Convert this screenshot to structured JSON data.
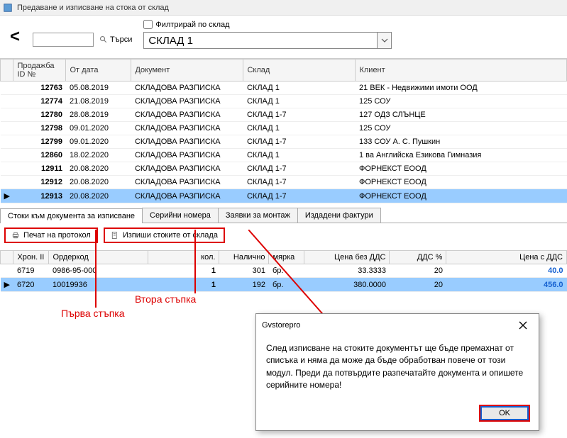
{
  "window": {
    "title": "Предаване и изписване на стока от склад"
  },
  "toolbar": {
    "back": "<",
    "search_btn": "Търси",
    "filter_label": "Филтрирай по склад",
    "warehouse": "СКЛАД 1"
  },
  "grid": {
    "headers": {
      "id": "Продажба ID №",
      "date": "От дата",
      "doc": "Документ",
      "whs": "Склад",
      "client": "Клиент"
    },
    "rows": [
      {
        "mark": "",
        "id": "12763",
        "date": "05.08.2019",
        "doc": "СКЛАДОВА РАЗПИСКА",
        "whs": "СКЛАД 1",
        "client": "21 ВЕК - Недвижими имоти ООД"
      },
      {
        "mark": "",
        "id": "12774",
        "date": "21.08.2019",
        "doc": "СКЛАДОВА РАЗПИСКА",
        "whs": "СКЛАД 1",
        "client": "125 СОУ"
      },
      {
        "mark": "",
        "id": "12780",
        "date": "28.08.2019",
        "doc": "СКЛАДОВА РАЗПИСКА",
        "whs": "СКЛАД 1-7",
        "client": "127 ОДЗ СЛЪНЦЕ"
      },
      {
        "mark": "",
        "id": "12798",
        "date": "09.01.2020",
        "doc": "СКЛАДОВА РАЗПИСКА",
        "whs": "СКЛАД 1",
        "client": "125 СОУ"
      },
      {
        "mark": "",
        "id": "12799",
        "date": "09.01.2020",
        "doc": "СКЛАДОВА РАЗПИСКА",
        "whs": "СКЛАД 1-7",
        "client": "133 СОУ А. С. Пушкин"
      },
      {
        "mark": "",
        "id": "12860",
        "date": "18.02.2020",
        "doc": "СКЛАДОВА РАЗПИСКА",
        "whs": "СКЛАД 1",
        "client": "1 ва Английска Езикова Гимназия"
      },
      {
        "mark": "",
        "id": "12911",
        "date": "20.08.2020",
        "doc": "СКЛАДОВА РАЗПИСКА",
        "whs": "СКЛАД 1-7",
        "client": "ФОРНЕКСТ ЕООД"
      },
      {
        "mark": "",
        "id": "12912",
        "date": "20.08.2020",
        "doc": "СКЛАДОВА РАЗПИСКА",
        "whs": "СКЛАД 1-7",
        "client": "ФОРНЕКСТ ЕООД"
      },
      {
        "mark": "▶",
        "id": "12913",
        "date": "20.08.2020",
        "doc": "СКЛАДОВА РАЗПИСКА",
        "whs": "СКЛАД 1-7",
        "client": "ФОРНЕКСТ ЕООД",
        "selected": true
      }
    ]
  },
  "tabs": {
    "items": [
      "Стоки към документа за изписване",
      "Серийни номера",
      "Заявки за монтаж",
      "Издадени фактури"
    ],
    "active": 0
  },
  "buttons": {
    "print": "Печат на протокол",
    "writeoff": "Изпиши стоките от склада"
  },
  "detail": {
    "headers": {
      "chron": "Хрон. II",
      "code": "Ордеркод",
      "qty": "кол.",
      "avail": "Налично",
      "unit": "мярка",
      "price": "Цена без ДДС",
      "vat": "ДДС %",
      "pricevat": "Цена с ДДС"
    },
    "rows": [
      {
        "mark": "",
        "chron": "6719",
        "code": "0986-95-000",
        "qty": "1",
        "avail": "301",
        "unit": "бр.",
        "price": "33.3333",
        "vat": "20",
        "pricevat": "40.0"
      },
      {
        "mark": "▶",
        "chron": "6720",
        "code": "10019936",
        "qty": "1",
        "avail": "192",
        "unit": "бр.",
        "price": "380.0000",
        "vat": "20",
        "pricevat": "456.0",
        "selected": true
      }
    ]
  },
  "annotations": {
    "step1": "Първа стъпка",
    "step2": "Втора стъпка"
  },
  "dialog": {
    "title": "Gvstorepro",
    "body": "След изписване на стоките документът ще бъде премахнат от списъка и няма да може да бъде обработван повече от този модул. Преди да потвърдите разпечатайте документа и опишете серийните номера!",
    "ok": "OK"
  }
}
